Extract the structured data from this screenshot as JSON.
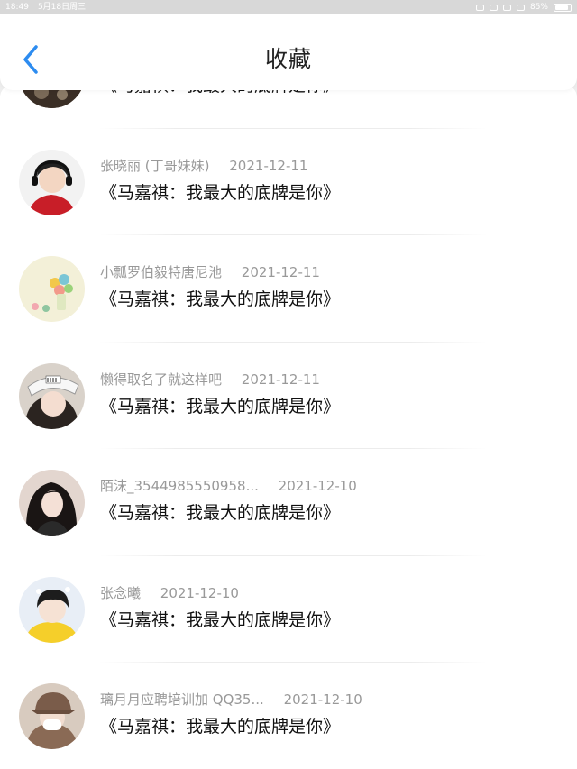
{
  "status_bar": {
    "time": "18:49",
    "date": "5月18日周三",
    "battery": "85%",
    "battery_level": 0.85
  },
  "header": {
    "title": "收藏",
    "back_icon": "chevron-left-icon",
    "accent_color": "#2d8cf0"
  },
  "favorites": [
    {
      "user": "",
      "date": "",
      "title": "《马嘉祺：我最大的底牌是你》",
      "avatar": "avatar-dark-partial"
    },
    {
      "user": "张晓丽 (丁哥妹妹)",
      "date": "2021-12-11",
      "title": "《马嘉祺：我最大的底牌是你》",
      "avatar": "avatar-boy-headset"
    },
    {
      "user": "小瓢罗伯毅特唐尼池",
      "date": "2021-12-11",
      "title": "《马嘉祺：我最大的底牌是你》",
      "avatar": "avatar-pastel-balls"
    },
    {
      "user": "懒得取名了就这样吧",
      "date": "2021-12-11",
      "title": "《马嘉祺：我最大的底牌是你》",
      "avatar": "avatar-girl-white-hat"
    },
    {
      "user": "陌沫_3544985550958...",
      "date": "2021-12-10",
      "title": "《马嘉祺：我最大的底牌是你》",
      "avatar": "avatar-girl-dark-hair"
    },
    {
      "user": "张念曦",
      "date": "2021-12-10",
      "title": "《马嘉祺：我最大的底牌是你》",
      "avatar": "avatar-boy-yellow"
    },
    {
      "user": "璃月月应聘培训加 QQ35...",
      "date": "2021-12-10",
      "title": "《马嘉祺：我最大的底牌是你》",
      "avatar": "avatar-girl-cap-mask"
    }
  ]
}
